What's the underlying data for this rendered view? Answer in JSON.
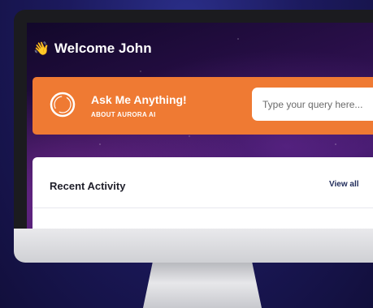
{
  "header": {
    "wave_emoji": "👋",
    "title": "Welcome John"
  },
  "banner": {
    "title": "Ask Me Anything!",
    "subtitle": "ABOUT AURORA AI",
    "search_placeholder": "Type your query here..."
  },
  "activity": {
    "title": "Recent Activity",
    "view_all_label": "View all"
  },
  "colors": {
    "accent": "#ef7a33",
    "card": "#ffffff",
    "bezel": "#1b1b1f"
  }
}
